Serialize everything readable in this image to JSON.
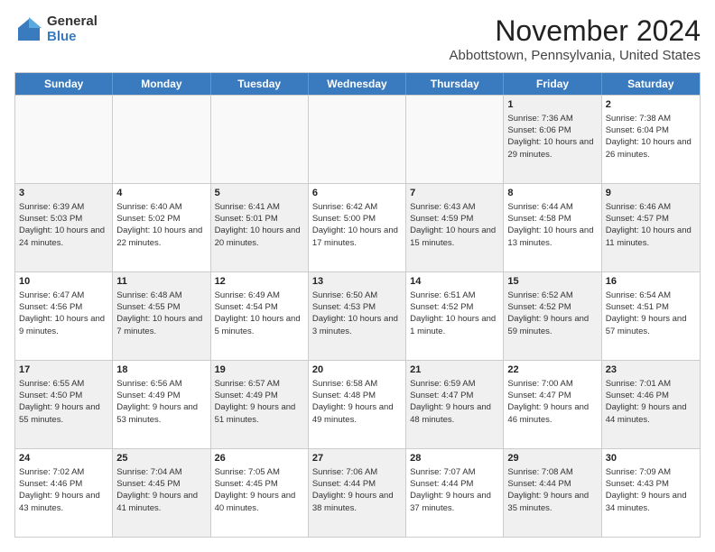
{
  "logo": {
    "general": "General",
    "blue": "Blue"
  },
  "header": {
    "month": "November 2024",
    "location": "Abbottstown, Pennsylvania, United States"
  },
  "days_of_week": [
    "Sunday",
    "Monday",
    "Tuesday",
    "Wednesday",
    "Thursday",
    "Friday",
    "Saturday"
  ],
  "weeks": [
    [
      {
        "day": "",
        "info": "",
        "empty": true
      },
      {
        "day": "",
        "info": "",
        "empty": true
      },
      {
        "day": "",
        "info": "",
        "empty": true
      },
      {
        "day": "",
        "info": "",
        "empty": true
      },
      {
        "day": "",
        "info": "",
        "empty": true
      },
      {
        "day": "1",
        "info": "Sunrise: 7:36 AM\nSunset: 6:06 PM\nDaylight: 10 hours and 29 minutes.",
        "shaded": true
      },
      {
        "day": "2",
        "info": "Sunrise: 7:38 AM\nSunset: 6:04 PM\nDaylight: 10 hours and 26 minutes.",
        "shaded": false
      }
    ],
    [
      {
        "day": "3",
        "info": "Sunrise: 6:39 AM\nSunset: 5:03 PM\nDaylight: 10 hours and 24 minutes.",
        "shaded": true
      },
      {
        "day": "4",
        "info": "Sunrise: 6:40 AM\nSunset: 5:02 PM\nDaylight: 10 hours and 22 minutes.",
        "shaded": false
      },
      {
        "day": "5",
        "info": "Sunrise: 6:41 AM\nSunset: 5:01 PM\nDaylight: 10 hours and 20 minutes.",
        "shaded": true
      },
      {
        "day": "6",
        "info": "Sunrise: 6:42 AM\nSunset: 5:00 PM\nDaylight: 10 hours and 17 minutes.",
        "shaded": false
      },
      {
        "day": "7",
        "info": "Sunrise: 6:43 AM\nSunset: 4:59 PM\nDaylight: 10 hours and 15 minutes.",
        "shaded": true
      },
      {
        "day": "8",
        "info": "Sunrise: 6:44 AM\nSunset: 4:58 PM\nDaylight: 10 hours and 13 minutes.",
        "shaded": false
      },
      {
        "day": "9",
        "info": "Sunrise: 6:46 AM\nSunset: 4:57 PM\nDaylight: 10 hours and 11 minutes.",
        "shaded": true
      }
    ],
    [
      {
        "day": "10",
        "info": "Sunrise: 6:47 AM\nSunset: 4:56 PM\nDaylight: 10 hours and 9 minutes.",
        "shaded": false
      },
      {
        "day": "11",
        "info": "Sunrise: 6:48 AM\nSunset: 4:55 PM\nDaylight: 10 hours and 7 minutes.",
        "shaded": true
      },
      {
        "day": "12",
        "info": "Sunrise: 6:49 AM\nSunset: 4:54 PM\nDaylight: 10 hours and 5 minutes.",
        "shaded": false
      },
      {
        "day": "13",
        "info": "Sunrise: 6:50 AM\nSunset: 4:53 PM\nDaylight: 10 hours and 3 minutes.",
        "shaded": true
      },
      {
        "day": "14",
        "info": "Sunrise: 6:51 AM\nSunset: 4:52 PM\nDaylight: 10 hours and 1 minute.",
        "shaded": false
      },
      {
        "day": "15",
        "info": "Sunrise: 6:52 AM\nSunset: 4:52 PM\nDaylight: 9 hours and 59 minutes.",
        "shaded": true
      },
      {
        "day": "16",
        "info": "Sunrise: 6:54 AM\nSunset: 4:51 PM\nDaylight: 9 hours and 57 minutes.",
        "shaded": false
      }
    ],
    [
      {
        "day": "17",
        "info": "Sunrise: 6:55 AM\nSunset: 4:50 PM\nDaylight: 9 hours and 55 minutes.",
        "shaded": true
      },
      {
        "day": "18",
        "info": "Sunrise: 6:56 AM\nSunset: 4:49 PM\nDaylight: 9 hours and 53 minutes.",
        "shaded": false
      },
      {
        "day": "19",
        "info": "Sunrise: 6:57 AM\nSunset: 4:49 PM\nDaylight: 9 hours and 51 minutes.",
        "shaded": true
      },
      {
        "day": "20",
        "info": "Sunrise: 6:58 AM\nSunset: 4:48 PM\nDaylight: 9 hours and 49 minutes.",
        "shaded": false
      },
      {
        "day": "21",
        "info": "Sunrise: 6:59 AM\nSunset: 4:47 PM\nDaylight: 9 hours and 48 minutes.",
        "shaded": true
      },
      {
        "day": "22",
        "info": "Sunrise: 7:00 AM\nSunset: 4:47 PM\nDaylight: 9 hours and 46 minutes.",
        "shaded": false
      },
      {
        "day": "23",
        "info": "Sunrise: 7:01 AM\nSunset: 4:46 PM\nDaylight: 9 hours and 44 minutes.",
        "shaded": true
      }
    ],
    [
      {
        "day": "24",
        "info": "Sunrise: 7:02 AM\nSunset: 4:46 PM\nDaylight: 9 hours and 43 minutes.",
        "shaded": false
      },
      {
        "day": "25",
        "info": "Sunrise: 7:04 AM\nSunset: 4:45 PM\nDaylight: 9 hours and 41 minutes.",
        "shaded": true
      },
      {
        "day": "26",
        "info": "Sunrise: 7:05 AM\nSunset: 4:45 PM\nDaylight: 9 hours and 40 minutes.",
        "shaded": false
      },
      {
        "day": "27",
        "info": "Sunrise: 7:06 AM\nSunset: 4:44 PM\nDaylight: 9 hours and 38 minutes.",
        "shaded": true
      },
      {
        "day": "28",
        "info": "Sunrise: 7:07 AM\nSunset: 4:44 PM\nDaylight: 9 hours and 37 minutes.",
        "shaded": false
      },
      {
        "day": "29",
        "info": "Sunrise: 7:08 AM\nSunset: 4:44 PM\nDaylight: 9 hours and 35 minutes.",
        "shaded": true
      },
      {
        "day": "30",
        "info": "Sunrise: 7:09 AM\nSunset: 4:43 PM\nDaylight: 9 hours and 34 minutes.",
        "shaded": false
      }
    ]
  ]
}
